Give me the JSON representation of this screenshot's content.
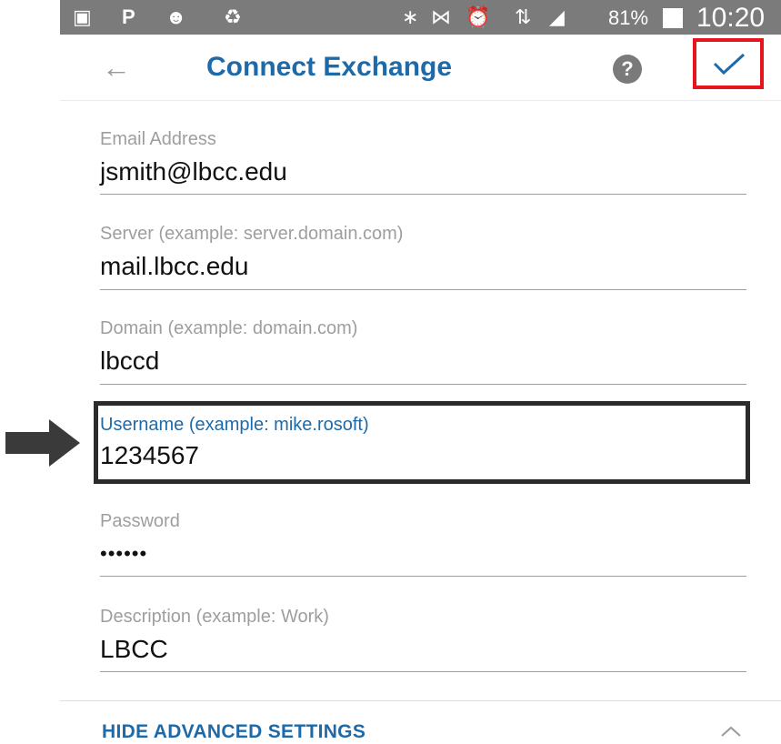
{
  "status_bar": {
    "battery_percent": "81%",
    "time": "10:20 AM"
  },
  "header": {
    "title": "Connect Exchange",
    "help_label": "?"
  },
  "fields": [
    {
      "label": "Email Address",
      "value": "jsmith@lbcc.edu"
    },
    {
      "label": "Server (example: server.domain.com)",
      "value": "mail.lbcc.edu"
    },
    {
      "label": "Domain (example: domain.com)",
      "value": "lbccd"
    },
    {
      "label": "Username (example: mike.rosoft)",
      "value": "1234567",
      "focused": true
    },
    {
      "label": "Password",
      "value": "••••••"
    },
    {
      "label": "Description (example: Work)",
      "value": "LBCC"
    }
  ],
  "advanced": {
    "label": "HIDE ADVANCED SETTINGS"
  },
  "colors": {
    "accent": "#1e6aa9",
    "highlight_red": "#e8141d",
    "annotation_dark": "#2b2b2b"
  }
}
